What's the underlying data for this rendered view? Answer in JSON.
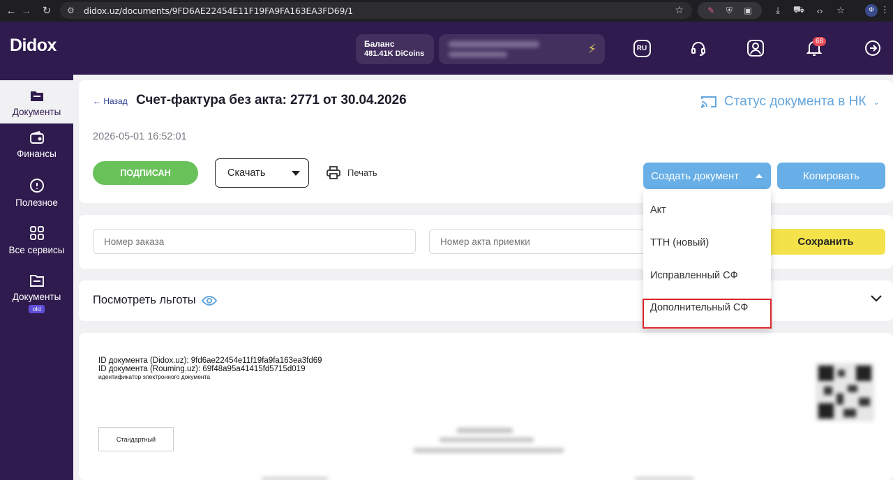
{
  "browser": {
    "url": "didox.uz/documents/9FD6AE22454E11F19FA9FA163EA3FD69/1",
    "profile_initial": "Ф"
  },
  "header": {
    "logo": "Didox",
    "balance_label": "Баланс",
    "balance_value": "481.41K DiCoins",
    "lang": "RU",
    "notifications_count": "68",
    "icons": [
      "headset-icon",
      "user-icon",
      "bell-icon",
      "logout-icon"
    ]
  },
  "sidebar": {
    "items": [
      {
        "label": "Документы",
        "icon": "folder-icon",
        "active": true
      },
      {
        "label": "Финансы",
        "icon": "wallet-icon"
      },
      {
        "label": "Полезное",
        "icon": "info-icon"
      },
      {
        "label": "Все сервисы",
        "icon": "grid-icon"
      },
      {
        "label": "Документы",
        "icon": "folder-icon",
        "badge": "old"
      }
    ]
  },
  "document": {
    "back_label": "Назад",
    "title": "Счет-фактура без акта: 2771 от 30.04.2026",
    "nk_status": "Статус документа в НК",
    "date": "2026-05-01 16:52:01",
    "status_label": "ПОДПИСАН",
    "download_label": "Скачать",
    "print_label": "Печать",
    "create_label": "Создать документ",
    "copy_label": "Копировать"
  },
  "form": {
    "order_placeholder": "Номер заказа",
    "act_placeholder": "Номер акта приемки",
    "save_label": "Сохранить"
  },
  "benefits": {
    "label": "Посмотреть льготы"
  },
  "dropdown": {
    "items": [
      "Акт",
      "ТТН (новый)",
      "Исправленный СФ",
      "Дополнительный СФ"
    ],
    "highlighted": "Дополнительный СФ"
  },
  "preview": {
    "id_didox": "ID документа (Didox.uz): 9fd6ae22454e11f19fa9fa163ea3fd69",
    "id_rouming": "ID документа (Rouming.uz): 69f48a95a41415fd5715d019",
    "id_caption": "идентификатор электронного документа",
    "type_box": "Стандартный"
  },
  "colors": {
    "brand_purple": "#2f1b4e",
    "accent_blue": "#67afe6",
    "signed_green": "#69c15a",
    "save_yellow": "#f3e24a",
    "highlight_red": "#d9262a"
  }
}
